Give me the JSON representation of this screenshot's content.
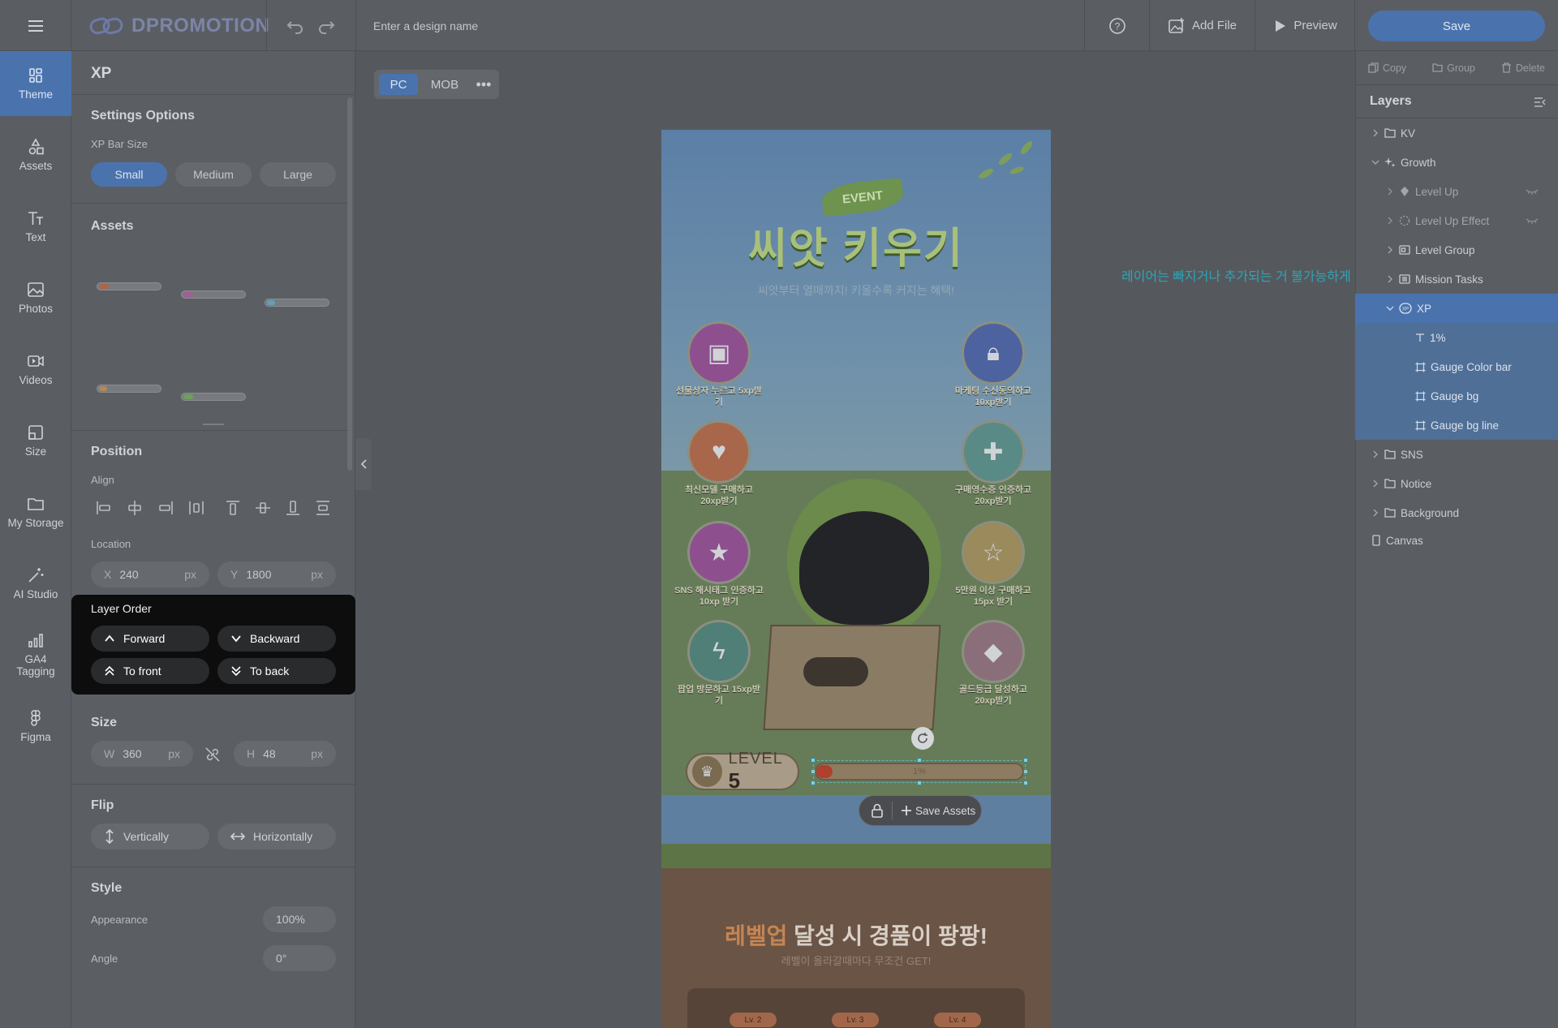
{
  "header": {
    "logo": "DPROMOTION",
    "design_name_placeholder": "Enter a design name",
    "add_file": "Add File",
    "preview": "Preview",
    "save": "Save"
  },
  "rail": {
    "items": [
      {
        "label": "Theme",
        "icon": "theme-icon",
        "active": true
      },
      {
        "label": "Assets",
        "icon": "shapes-icon"
      },
      {
        "label": "Text",
        "icon": "text-icon"
      },
      {
        "label": "Photos",
        "icon": "photo-icon"
      },
      {
        "label": "Videos",
        "icon": "video-icon"
      },
      {
        "label": "Size",
        "icon": "size-icon"
      },
      {
        "label": "My Storage",
        "icon": "folder-icon"
      },
      {
        "label": "AI Studio",
        "icon": "magic-wand-icon"
      },
      {
        "label": "GA4 Tagging",
        "icon": "bar-chart-icon"
      },
      {
        "label": "Figma",
        "icon": "figma-icon"
      }
    ]
  },
  "panel": {
    "title": "XP",
    "settings_title": "Settings Options",
    "bar_size_label": "XP Bar Size",
    "sizes": [
      "Small",
      "Medium",
      "Large"
    ],
    "selected_size": "Small",
    "assets_title": "Assets",
    "position_title": "Position",
    "align_label": "Align",
    "location_label": "Location",
    "x": {
      "label": "X",
      "value": "240",
      "unit": "px"
    },
    "y": {
      "label": "Y",
      "value": "1800",
      "unit": "px"
    },
    "layer_order": {
      "title": "Layer Order",
      "forward": "Forward",
      "backward": "Backward",
      "to_front": "To front",
      "to_back": "To back"
    },
    "size_title": "Size",
    "w": {
      "label": "W",
      "value": "360",
      "unit": "px"
    },
    "h": {
      "label": "H",
      "value": "48",
      "unit": "px"
    },
    "flip_title": "Flip",
    "flip_v": "Vertically",
    "flip_h": "Horizontally",
    "style_title": "Style",
    "appearance_label": "Appearance",
    "appearance_value": "100%",
    "angle_label": "Angle",
    "angle_value": "0°"
  },
  "canvas": {
    "tabs": [
      "PC",
      "MOB"
    ],
    "active_tab": "PC",
    "note": "레이어는 빠지거나 추가되는 거 불가능하게",
    "art": {
      "event": "EVENT",
      "title": "씨앗 키우기",
      "subtitle": "씨앗부터 열매까지! 키울수록 커지는 혜택!",
      "missions": [
        {
          "caption": "선물상자 누르고 5xp받기",
          "icon": "treasure-chest-icon",
          "color": "#8e4f8f"
        },
        {
          "caption": "마케팅 수신동의하고 10xp받기",
          "icon": "padlock-icon",
          "color": "#4d63a0"
        },
        {
          "caption": "최신모델 구매하고 20xp받기",
          "icon": "shopping-bag-icon",
          "color": "#a8674a"
        },
        {
          "caption": "구매영수증 인증하고 20xp받기",
          "icon": "gift-box-icon",
          "color": "#5a8a86"
        },
        {
          "caption": "SNS 해시태그 인증하고 10xp 받기",
          "icon": "book-icon",
          "color": "#8e4f8f"
        },
        {
          "caption": "5만원 이상 구매하고 15px 받기",
          "icon": "star-coin-icon",
          "color": "#9a8a5c"
        },
        {
          "caption": "팝업 방문하고 15xp받기",
          "icon": "lightning-icon",
          "color": "#4f7f76"
        },
        {
          "caption": "골드등급 달성하고 20xp받기",
          "icon": "gem-icon",
          "color": "#8a6f7a"
        }
      ],
      "level_label": "LEVEL",
      "level_value": "5",
      "xp_text": "1%",
      "xp_progress": 0.01,
      "save_assets": "Save Assets",
      "reward_title_accent": "레벨업",
      "reward_title_rest": " 달성 시 경품이 팡팡!",
      "reward_sub": "레벨이 올라갈때마다 무조건 GET!",
      "levels": [
        "Lv. 2",
        "Lv. 3",
        "Lv. 4"
      ]
    }
  },
  "right": {
    "copy": "Copy",
    "group": "Group",
    "delete": "Delete",
    "layers_title": "Layers",
    "layers": [
      {
        "label": "KV",
        "icon": "folder-icon"
      },
      {
        "label": "Growth",
        "icon": "sparkle-icon",
        "expanded": true
      },
      {
        "label": "Level Up",
        "icon": "diamond-icon"
      },
      {
        "label": "Level Up Effect",
        "icon": "dashed-circle-icon"
      },
      {
        "label": "Level Group",
        "icon": "group-icon"
      },
      {
        "label": "Mission Tasks",
        "icon": "list-icon"
      },
      {
        "label": "XP",
        "icon": "xp-icon",
        "selected": true
      },
      {
        "label": "1%",
        "icon": "text-icon"
      },
      {
        "label": "Gauge Color bar",
        "icon": "frame-icon"
      },
      {
        "label": "Gauge bg",
        "icon": "frame-icon"
      },
      {
        "label": "Gauge bg line",
        "icon": "frame-icon"
      },
      {
        "label": "SNS",
        "icon": "folder-icon"
      },
      {
        "label": "Notice",
        "icon": "folder-icon"
      },
      {
        "label": "Background",
        "icon": "folder-icon"
      },
      {
        "label": "Canvas",
        "icon": "canvas-icon"
      }
    ]
  }
}
